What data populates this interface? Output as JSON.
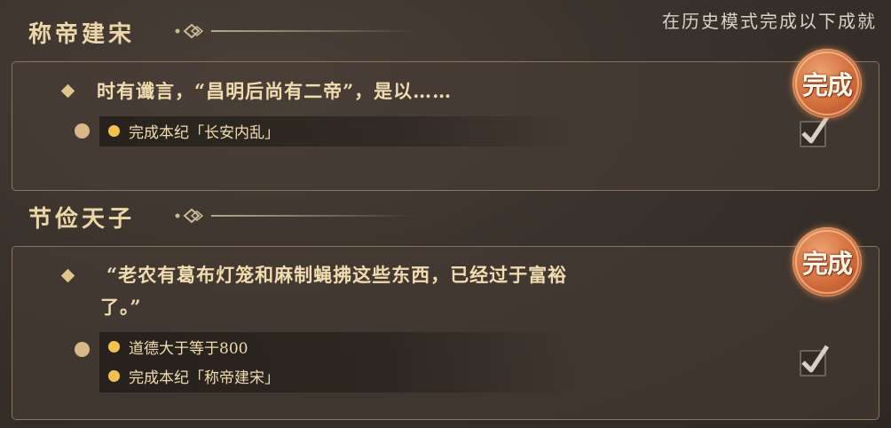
{
  "header": {
    "note": "在历史模式完成以下成就"
  },
  "achievements": [
    {
      "title": "称帝建宋",
      "quote": "时有谶言，“昌明后尚有二帝”，是以……",
      "requirements": [
        "完成本纪「长安内乱」"
      ],
      "status": "完成",
      "checked": true
    },
    {
      "title": "节俭天子",
      "quote_line1": "“老农有葛布灯笼和麻制蝇拂这些东西，已经过于富裕",
      "quote_line2": "了。”",
      "requirements": [
        "道德大于等于800",
        "完成本纪「称帝建宋」"
      ],
      "status": "完成",
      "checked": true
    }
  ],
  "colors": {
    "accent": "#ecd7a8",
    "seal": "#d06b3b",
    "dot": "#f3c24d"
  },
  "icons": [
    "diamond-bullet-icon",
    "circle-bullet-icon",
    "check-icon",
    "complete-seal-icon",
    "title-ornament-icon"
  ]
}
